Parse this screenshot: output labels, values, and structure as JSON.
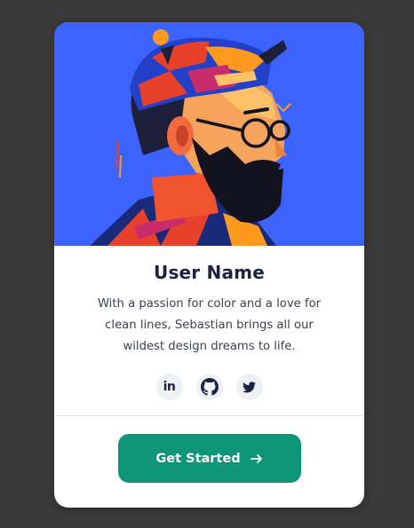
{
  "card": {
    "name": "User Name",
    "bio": "With a passion for color and a love for clean lines, Sebastian brings all our wildest design dreams to life.",
    "socials": [
      {
        "icon": "linkedin-icon",
        "glyph": "in"
      },
      {
        "icon": "github-icon"
      },
      {
        "icon": "twitter-icon"
      }
    ],
    "cta": {
      "label": "Get Started",
      "icon": "arrow-right-icon"
    }
  },
  "colors": {
    "page_background": "#3a3a3a",
    "card_background": "#ffffff",
    "hero_background": "#3d63ff",
    "name_color": "#1c2340",
    "cta_background": "#0f9678",
    "social_background": "#eef1f4"
  }
}
